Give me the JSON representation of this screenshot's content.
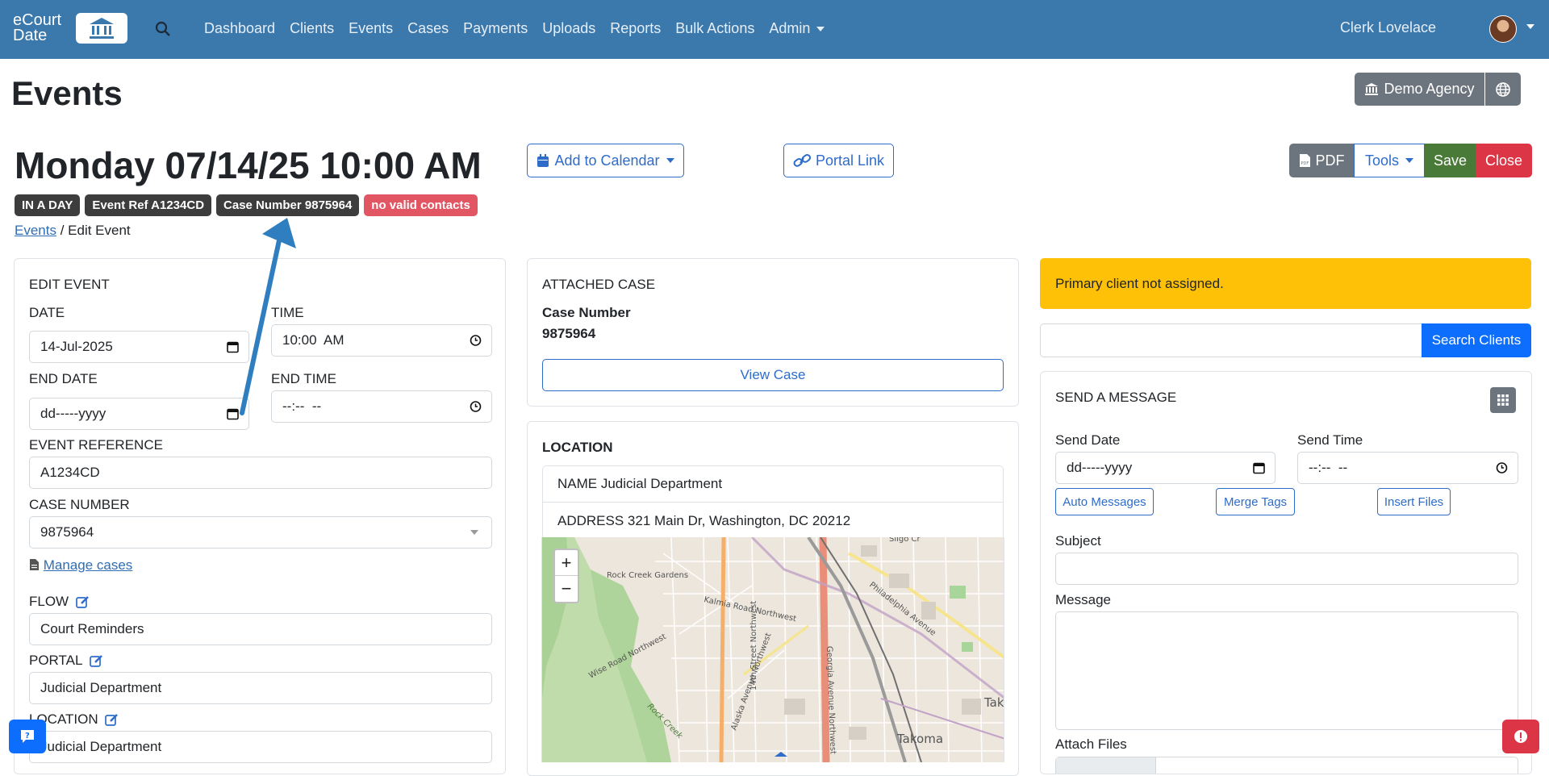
{
  "nav": {
    "logo_line1": "eCourt",
    "logo_line2": "Date",
    "links": [
      "Dashboard",
      "Clients",
      "Events",
      "Cases",
      "Payments",
      "Uploads",
      "Reports",
      "Bulk Actions",
      "Admin"
    ],
    "user": "Clerk Lovelace"
  },
  "header": {
    "title": "Events",
    "agency": "Demo Agency"
  },
  "event": {
    "datetime": "Monday 07/14/25 10:00 AM",
    "badges": [
      "IN A DAY",
      "Event Ref A1234CD",
      "Case Number 9875964",
      "no valid contacts"
    ],
    "breadcrumb_link": "Events",
    "breadcrumb_rest": " / Edit Event"
  },
  "actions": {
    "add_calendar": "Add to Calendar",
    "portal_link": "Portal Link",
    "pdf": "PDF",
    "tools": "Tools",
    "save": "Save",
    "close": "Close"
  },
  "edit_event": {
    "heading": "EDIT EVENT",
    "date_label": "DATE",
    "date_value": "14-Jul-2025",
    "time_label": "TIME",
    "time_value": "10:00  AM",
    "end_date_label": "END DATE",
    "end_date_value": "dd-----yyyy",
    "end_time_label": "END TIME",
    "end_time_value": "--:--  --",
    "event_ref_label": "EVENT REFERENCE",
    "event_ref_value": "A1234CD",
    "case_number_label": "CASE NUMBER",
    "case_number_value": "9875964",
    "manage_cases": "Manage cases",
    "flow_label": "FLOW",
    "flow_value": "Court Reminders",
    "portal_label": "PORTAL",
    "portal_value": "Judicial Department",
    "location_label": "LOCATION",
    "location_value": "Judicial Department"
  },
  "attached_case": {
    "heading": "ATTACHED CASE",
    "case_label": "Case Number",
    "case_value": "9875964",
    "view_case": "View Case"
  },
  "location": {
    "heading": "LOCATION",
    "name": "NAME Judicial Department",
    "address": "ADDRESS 321 Main Dr, Washington, DC 20212",
    "map_labels": [
      "Rock Creek Gardens",
      "Kalmia Road Northwest",
      "Wise Road Northwest",
      "14th Street Northwest",
      "Alaska Avenue Northwest",
      "Georgia Avenue Northwest",
      "Philadelphia Avenue",
      "Rock Creek",
      "Sligo Cr",
      "Tak",
      "Takoma"
    ]
  },
  "client": {
    "alert": "Primary client not assigned.",
    "search_button": "Search Clients",
    "search_value": ""
  },
  "message": {
    "heading": "SEND A MESSAGE",
    "send_date_label": "Send Date",
    "send_date_value": "dd-----yyyy",
    "send_time_label": "Send Time",
    "send_time_value": "--:--  --",
    "auto_messages": "Auto Messages",
    "merge_tags": "Merge Tags",
    "insert_files": "Insert Files",
    "subject_label": "Subject",
    "message_label": "Message",
    "attach_files_label": "Attach Files"
  },
  "colors": {
    "navbar": "#3b79ad",
    "primary": "#0d6efd",
    "success": "#4a7a37",
    "danger": "#dc3545",
    "warning": "#ffc107",
    "arrow": "#2e7ec0"
  }
}
